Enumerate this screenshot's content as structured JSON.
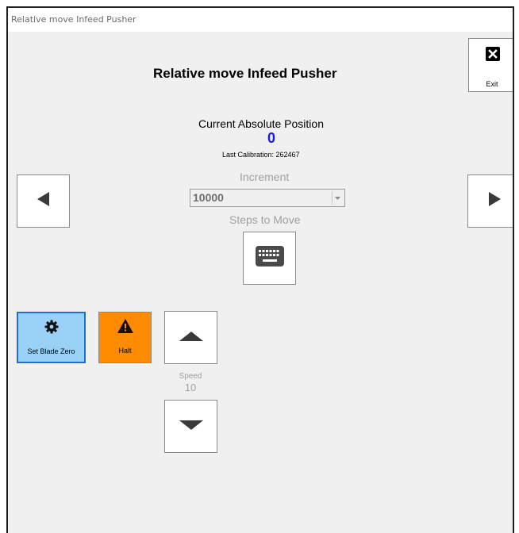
{
  "window": {
    "title": "Relative move Infeed Pusher"
  },
  "header": {
    "title": "Relative move Infeed Pusher"
  },
  "exit_button": {
    "label": "Exit",
    "icon": "close-box-icon"
  },
  "position": {
    "label": "Current Absolute Position",
    "value": "0",
    "value_color": "#1a1ae6",
    "last_calibration": "Last Calibration: 262467"
  },
  "increment": {
    "label": "Increment",
    "selected": "10000"
  },
  "steps": {
    "label": "Steps to Move",
    "icon": "keyboard-icon"
  },
  "nav": {
    "left_icon": "arrow-left-icon",
    "right_icon": "arrow-right-icon"
  },
  "tiles": {
    "set_blade_zero": {
      "label": "Set Blade Zero",
      "icon": "gear-icon",
      "color": "#99d1f7",
      "border": "#1b6fd8"
    },
    "halt": {
      "label": "Halt",
      "icon": "warning-icon",
      "color": "#ff8c00"
    }
  },
  "speed": {
    "label": "Speed",
    "value": "10",
    "up_icon": "arrow-up-icon",
    "down_icon": "arrow-down-icon"
  }
}
